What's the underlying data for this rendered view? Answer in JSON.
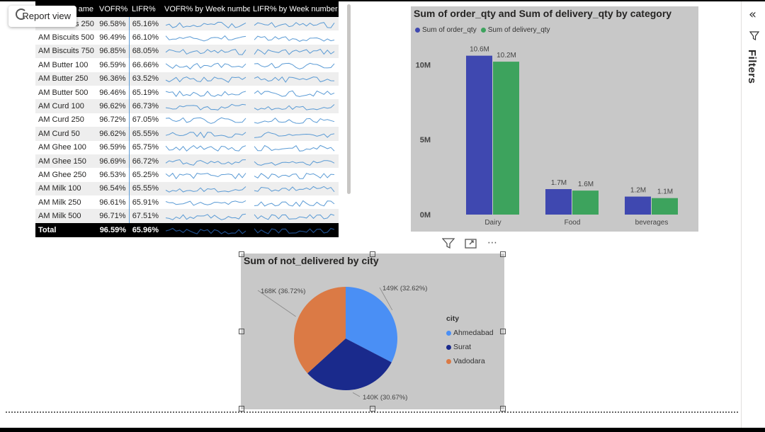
{
  "report_view_label": "Report view",
  "filters_pane": {
    "label": "Filters",
    "collapse_icon": "double-chevron-left-icon",
    "filter_icon": "filter-icon"
  },
  "table": {
    "headers": [
      "ame",
      "VOFR%",
      "LIFR%",
      "VOFR% by Week number",
      "LIFR% by Week number"
    ],
    "rows": [
      {
        "name": "AM Biscuits 250",
        "vofr": "96.58%",
        "lifr": "65.16%"
      },
      {
        "name": "AM Biscuits 500",
        "vofr": "96.49%",
        "lifr": "66.10%"
      },
      {
        "name": "AM Biscuits 750",
        "vofr": "96.85%",
        "lifr": "68.05%"
      },
      {
        "name": "AM Butter 100",
        "vofr": "96.59%",
        "lifr": "66.66%"
      },
      {
        "name": "AM Butter 250",
        "vofr": "96.36%",
        "lifr": "63.52%"
      },
      {
        "name": "AM Butter 500",
        "vofr": "96.46%",
        "lifr": "65.19%"
      },
      {
        "name": "AM Curd 100",
        "vofr": "96.62%",
        "lifr": "66.73%"
      },
      {
        "name": "AM Curd 250",
        "vofr": "96.72%",
        "lifr": "67.05%"
      },
      {
        "name": "AM Curd 50",
        "vofr": "96.62%",
        "lifr": "65.55%"
      },
      {
        "name": "AM Ghee 100",
        "vofr": "96.59%",
        "lifr": "65.75%"
      },
      {
        "name": "AM Ghee 150",
        "vofr": "96.69%",
        "lifr": "66.72%"
      },
      {
        "name": "AM Ghee 250",
        "vofr": "96.53%",
        "lifr": "65.25%"
      },
      {
        "name": "AM Milk 100",
        "vofr": "96.54%",
        "lifr": "65.55%"
      },
      {
        "name": "AM Milk 250",
        "vofr": "96.61%",
        "lifr": "65.91%"
      },
      {
        "name": "AM Milk 500",
        "vofr": "96.71%",
        "lifr": "67.51%"
      }
    ],
    "total": {
      "name": "Total",
      "vofr": "96.59%",
      "lifr": "65.96%"
    },
    "colors": {
      "header_bg": "#000000",
      "sparkline": "#5b9bd5"
    }
  },
  "chart_data": [
    {
      "type": "bar",
      "title": "Sum of order_qty and Sum of delivery_qty by category",
      "categories": [
        "Dairy",
        "Food",
        "beverages"
      ],
      "series": [
        {
          "name": "Sum of order_qty",
          "values": [
            10.6,
            1.7,
            1.2
          ],
          "labels": [
            "10.6M",
            "1.7M",
            "1.2M"
          ],
          "color": "#3f48b0"
        },
        {
          "name": "Sum of delivery_qty",
          "values": [
            10.2,
            1.6,
            1.1
          ],
          "labels": [
            "10.2M",
            "1.6M",
            "1.1M"
          ],
          "color": "#3da35d"
        }
      ],
      "yticks": [
        "0M",
        "5M",
        "10M"
      ],
      "ylim": [
        0,
        12
      ],
      "units": "M",
      "legend": "top-left",
      "grid": false
    },
    {
      "type": "pie",
      "title": "Sum of not_delivered by city",
      "legend_title": "city",
      "legend": "right",
      "slices": [
        {
          "name": "Ahmedabad",
          "value": 149,
          "label": "149K (32.62%)",
          "color": "#4a8ff5"
        },
        {
          "name": "Surat",
          "value": 140,
          "label": "140K (30.67%)",
          "color": "#1a2a8c"
        },
        {
          "name": "Vadodara",
          "value": 168,
          "label": "168K (36.72%)",
          "color": "#db7a45"
        }
      ]
    }
  ],
  "visual_header": {
    "icons": [
      "filter-icon",
      "focus-mode-icon",
      "more-options-icon"
    ],
    "more_glyph": "⋯"
  }
}
